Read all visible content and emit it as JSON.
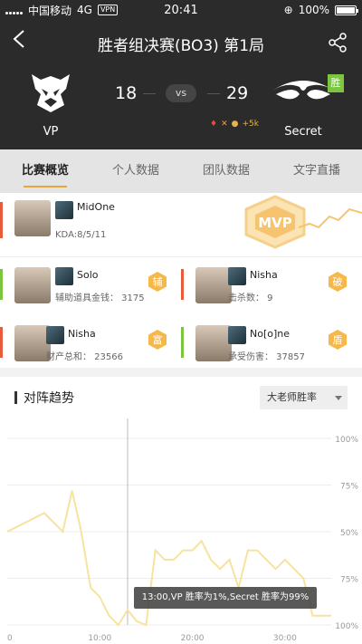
{
  "status_bar": {
    "carrier": "中国移动",
    "network": "4G",
    "vpn": "VPN",
    "time": "20:41",
    "battery": "100%"
  },
  "header": {
    "title": "胜者组决赛(BO3) 第1局"
  },
  "match": {
    "team_left": {
      "name": "VP",
      "score": "18"
    },
    "team_right": {
      "name": "Secret",
      "score": "29",
      "badge": "胜"
    },
    "vs": "vs",
    "gold_adv": "+5k"
  },
  "tabs": [
    {
      "label": "比赛概览",
      "active": true
    },
    {
      "label": "个人数据",
      "active": false
    },
    {
      "label": "团队数据",
      "active": false
    },
    {
      "label": "文字直播",
      "active": false
    }
  ],
  "mvp": {
    "name": "MidOne",
    "stat": "KDA:8/5/11",
    "badge": "MVP"
  },
  "awards": [
    {
      "name": "Solo",
      "stat": "辅助道具金钱： 3175",
      "tag": "辅",
      "team": "VP"
    },
    {
      "name": "Nisha",
      "stat": "击杀数： 9",
      "tag": "破",
      "team": "Secret"
    },
    {
      "name": "Nisha",
      "stat": "财产总和： 23566",
      "tag": "富",
      "team": "Secret"
    },
    {
      "name": "No[o]ne",
      "stat": "承受伤害： 37857",
      "tag": "盾",
      "team": "VP"
    }
  ],
  "trend": {
    "title": "对阵趋势",
    "select": "大老师胜率"
  },
  "chart_data": {
    "type": "line",
    "x_ticks": [
      "0",
      "10:00",
      "20:00",
      "30:00"
    ],
    "y_ticks": [
      "100%",
      "75%",
      "50%",
      "75%",
      "100%"
    ],
    "x": [
      0,
      2,
      4,
      6,
      7,
      8,
      9,
      10,
      11,
      12,
      13,
      14,
      15,
      16,
      17,
      18,
      19,
      20,
      21,
      22,
      23,
      24,
      25,
      26,
      27,
      28,
      29,
      30,
      31,
      32,
      33,
      34,
      35
    ],
    "values": [
      50,
      55,
      60,
      50,
      72,
      50,
      20,
      15,
      5,
      0,
      8,
      2,
      0,
      40,
      35,
      35,
      40,
      40,
      45,
      35,
      30,
      35,
      20,
      40,
      40,
      35,
      30,
      35,
      30,
      25,
      5,
      5,
      5
    ],
    "tooltip": "13:00,VP 胜率为1%,Secret 胜率为99%",
    "colors": {
      "line": "#f6e3a0",
      "grid": "#ededed",
      "cursor": "#bbbbbb"
    }
  }
}
